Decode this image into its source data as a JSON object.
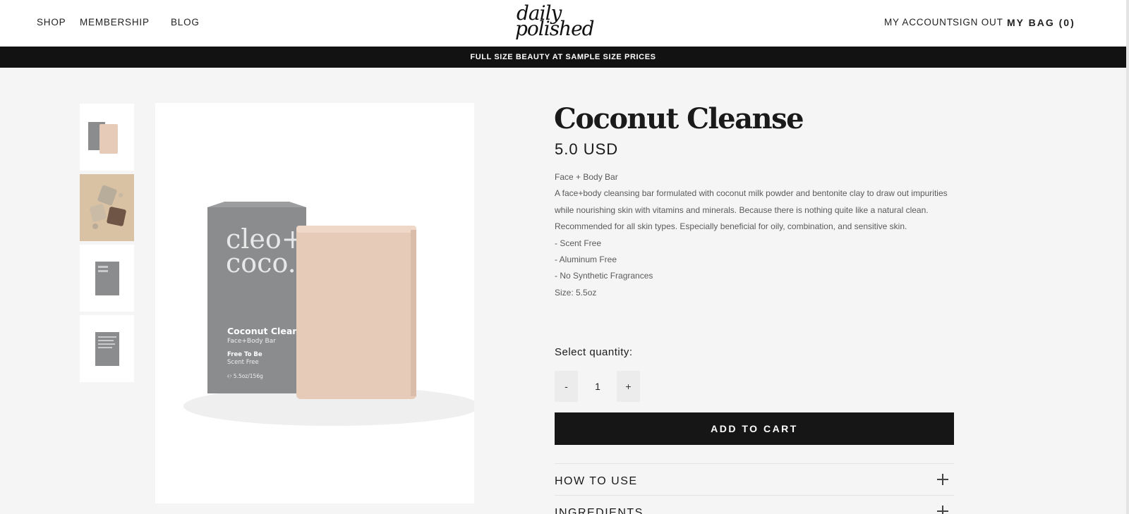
{
  "nav": {
    "shop": "SHOP",
    "membership": "MEMBERSHIP",
    "blog": "BLOG",
    "logo_line1": "daily",
    "logo_line2": "polished",
    "my_account": "MY ACCOUNT",
    "sign_out": "SIGN OUT",
    "my_bag": "MY BAG (0)"
  },
  "promo": "FULL SIZE BEAUTY AT SAMPLE SIZE PRICES",
  "gallery": {
    "box_brand_line1": "cleo+",
    "box_brand_line2": "coco.",
    "box_product": "Coconut Cleans",
    "box_type": "Face+Body Bar",
    "box_claim1": "Free To Be",
    "box_claim2": "Scent Free",
    "box_weight": "℮ 5.5oz/156g"
  },
  "product": {
    "title": "Coconut Cleanse",
    "price": "5.0 USD",
    "description": [
      "Face + Body Bar",
      "A face+body cleansing bar formulated with coconut milk powder and bentonite clay to draw out impurities while nourishing skin with vitamins and minerals. Because there is nothing quite like a natural clean.",
      "Recommended for all skin types. Especially beneficial for oily, combination, and sensitive skin.",
      "- Scent Free",
      "- Aluminum Free",
      "- No Synthetic Fragrances",
      "Size: 5.5oz"
    ]
  },
  "quantity": {
    "label": "Select quantity:",
    "minus": "-",
    "value": "1",
    "plus": "+"
  },
  "add_to_cart": "ADD TO CART",
  "accordion": [
    {
      "label": "HOW TO USE"
    },
    {
      "label": "INGREDIENTS"
    }
  ],
  "colors": {
    "background": "#f5f5f5",
    "promo_bar": "#121212",
    "button": "#161616",
    "soap": "#e6cbb9",
    "box": "#8a8c8e"
  }
}
